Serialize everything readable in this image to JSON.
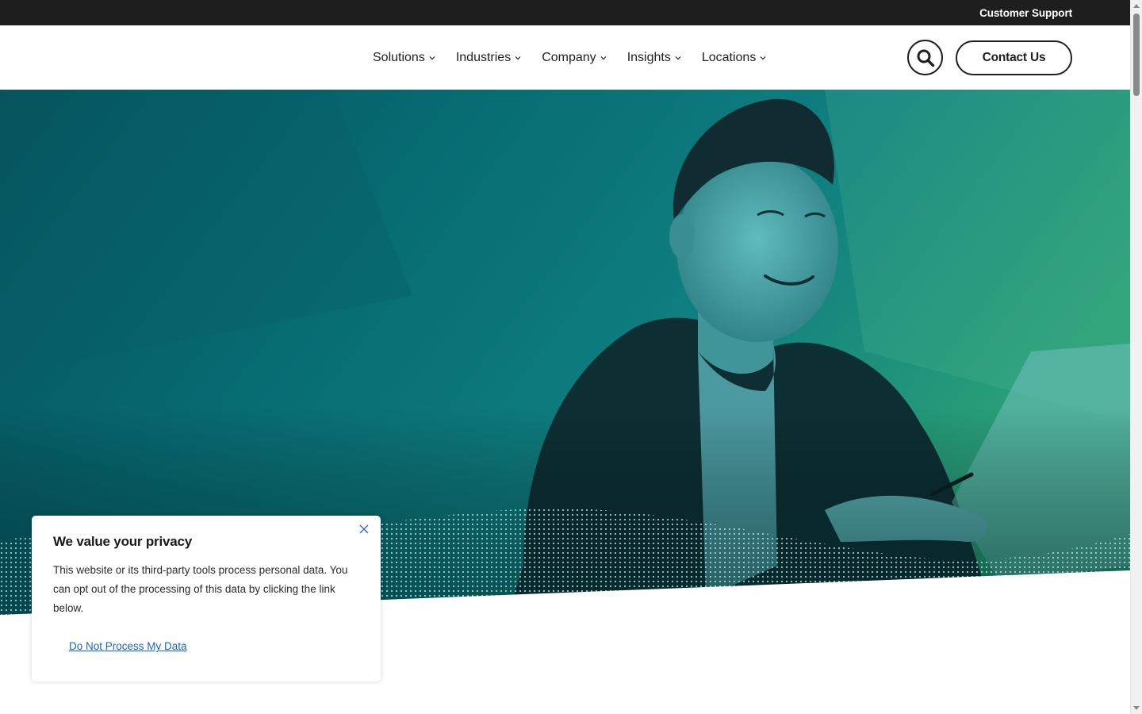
{
  "topbar": {
    "support_link": "Customer Support"
  },
  "nav": {
    "items": [
      {
        "label": "Solutions"
      },
      {
        "label": "Industries"
      },
      {
        "label": "Company"
      },
      {
        "label": "Insights"
      },
      {
        "label": "Locations"
      }
    ],
    "search_icon": "search-icon",
    "contact_label": "Contact Us"
  },
  "hero": {
    "image": "smiling-man-at-laptop-teal-duotone",
    "colors": {
      "dark_teal": "#064a52",
      "mid_teal": "#0e7a80",
      "green": "#2a9e74"
    }
  },
  "cookie_banner": {
    "title": "We value your privacy",
    "body": "This website or its third-party tools process personal data. You can opt out of the processing of this data by clicking the link below.",
    "link": "Do Not Process My Data",
    "close_icon": "close-icon"
  },
  "colors": {
    "topbar_bg": "#1e1e1e",
    "link": "#1a66c2",
    "text": "#1f1f1f"
  }
}
